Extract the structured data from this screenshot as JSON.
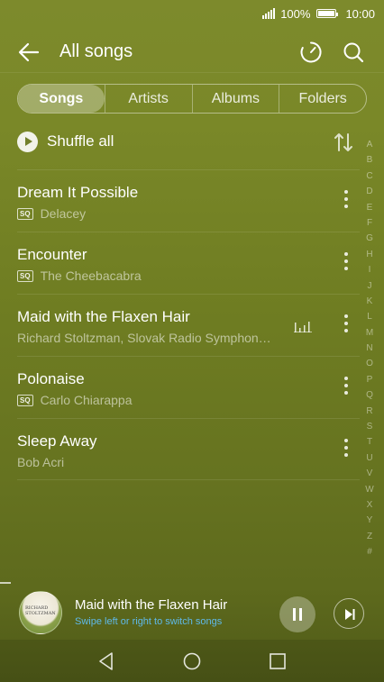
{
  "status_bar": {
    "battery_text": "100%",
    "battery_level": 1.0,
    "time": "10:00"
  },
  "header": {
    "title": "All songs",
    "icons": [
      "back-arrow-icon",
      "timer-icon",
      "search-icon"
    ]
  },
  "tabs": [
    {
      "label": "Songs",
      "active": true
    },
    {
      "label": "Artists",
      "active": false
    },
    {
      "label": "Albums",
      "active": false
    },
    {
      "label": "Folders",
      "active": false
    }
  ],
  "shuffle": {
    "label": "Shuffle all"
  },
  "songs": [
    {
      "title": "Dream It Possible",
      "artist": "Delacey",
      "sq": true,
      "playing": false
    },
    {
      "title": "Encounter",
      "artist": "The Cheebacabra",
      "sq": true,
      "playing": false
    },
    {
      "title": "Maid with the Flaxen Hair",
      "artist": "Richard Stoltzman, Slovak Radio Symphon…",
      "sq": false,
      "playing": true
    },
    {
      "title": "Polonaise",
      "artist": "Carlo Chiarappa",
      "sq": true,
      "playing": false
    },
    {
      "title": "Sleep Away",
      "artist": "Bob Acri",
      "sq": false,
      "playing": false
    }
  ],
  "sq_badge": "SQ",
  "alphabet": [
    "A",
    "B",
    "C",
    "D",
    "E",
    "F",
    "G",
    "H",
    "I",
    "J",
    "K",
    "L",
    "M",
    "N",
    "O",
    "P",
    "Q",
    "R",
    "S",
    "T",
    "U",
    "V",
    "W",
    "X",
    "Y",
    "Z",
    "#"
  ],
  "now_playing": {
    "title": "Maid with the Flaxen Hair",
    "hint": "Swipe left or right to switch songs",
    "art_text_1": "RICHARD",
    "art_text_2": "STOLTZMAN"
  },
  "colors": {
    "background": "#72802a",
    "hint": "#5fb9ea"
  }
}
